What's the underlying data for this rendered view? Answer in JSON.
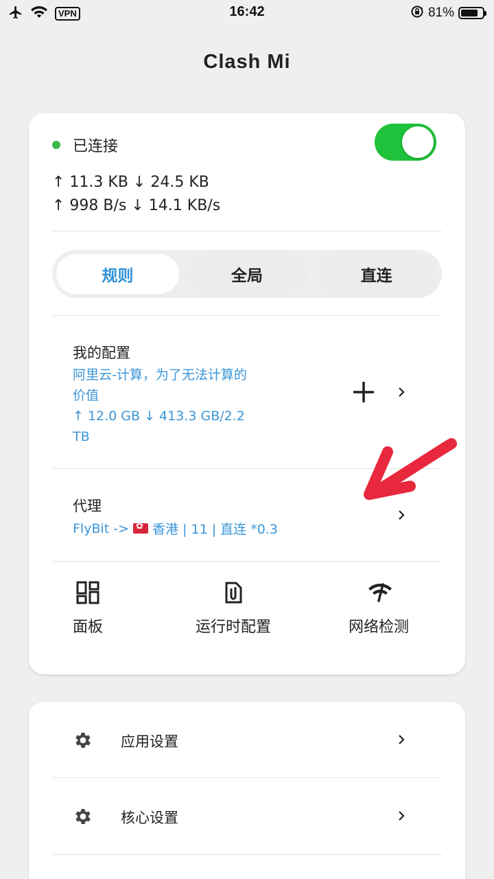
{
  "status_bar": {
    "vpn_label": "VPN",
    "time": "16:42",
    "battery_percent": "81%",
    "battery_level": 0.81,
    "icons": [
      "airplane-icon",
      "wifi-icon",
      "rotation-lock-icon",
      "battery-icon"
    ]
  },
  "app": {
    "title": "Clash Mi"
  },
  "connection": {
    "status": "已连接",
    "status_color": "#3cb54a",
    "toggle_on": true,
    "toggle_color": "#1fc23a",
    "traffic_total": "↑ 11.3 KB  ↓ 24.5 KB",
    "traffic_speed": "↑ 998 B/s  ↓ 14.1 KB/s"
  },
  "modes": {
    "tabs": [
      {
        "label": "规则",
        "active": true
      },
      {
        "label": "全局",
        "active": false
      },
      {
        "label": "直连",
        "active": false
      }
    ],
    "accent_color": "#2f8fd6"
  },
  "profile": {
    "label": "我的配置",
    "name_line1": "阿里云-计算，为了无法计算的",
    "name_line2": "价值",
    "usage_line1": "↑ 12.0 GB ↓ 413.3 GB/2.2",
    "usage_line2": "TB"
  },
  "proxy": {
    "label": "代理",
    "info_prefix": "FlyBit ->",
    "info_suffix": "香港 | 11 | 直连 *0.3"
  },
  "tools": [
    {
      "label": "面板",
      "icon": "dashboard-icon"
    },
    {
      "label": "运行时配置",
      "icon": "file-icon"
    },
    {
      "label": "网络检测",
      "icon": "network-check-icon"
    }
  ],
  "settings": [
    {
      "label": "应用设置",
      "icon": "gear-icon"
    },
    {
      "label": "核心设置",
      "icon": "gear-icon"
    }
  ],
  "annotation_color": "#e8283c"
}
